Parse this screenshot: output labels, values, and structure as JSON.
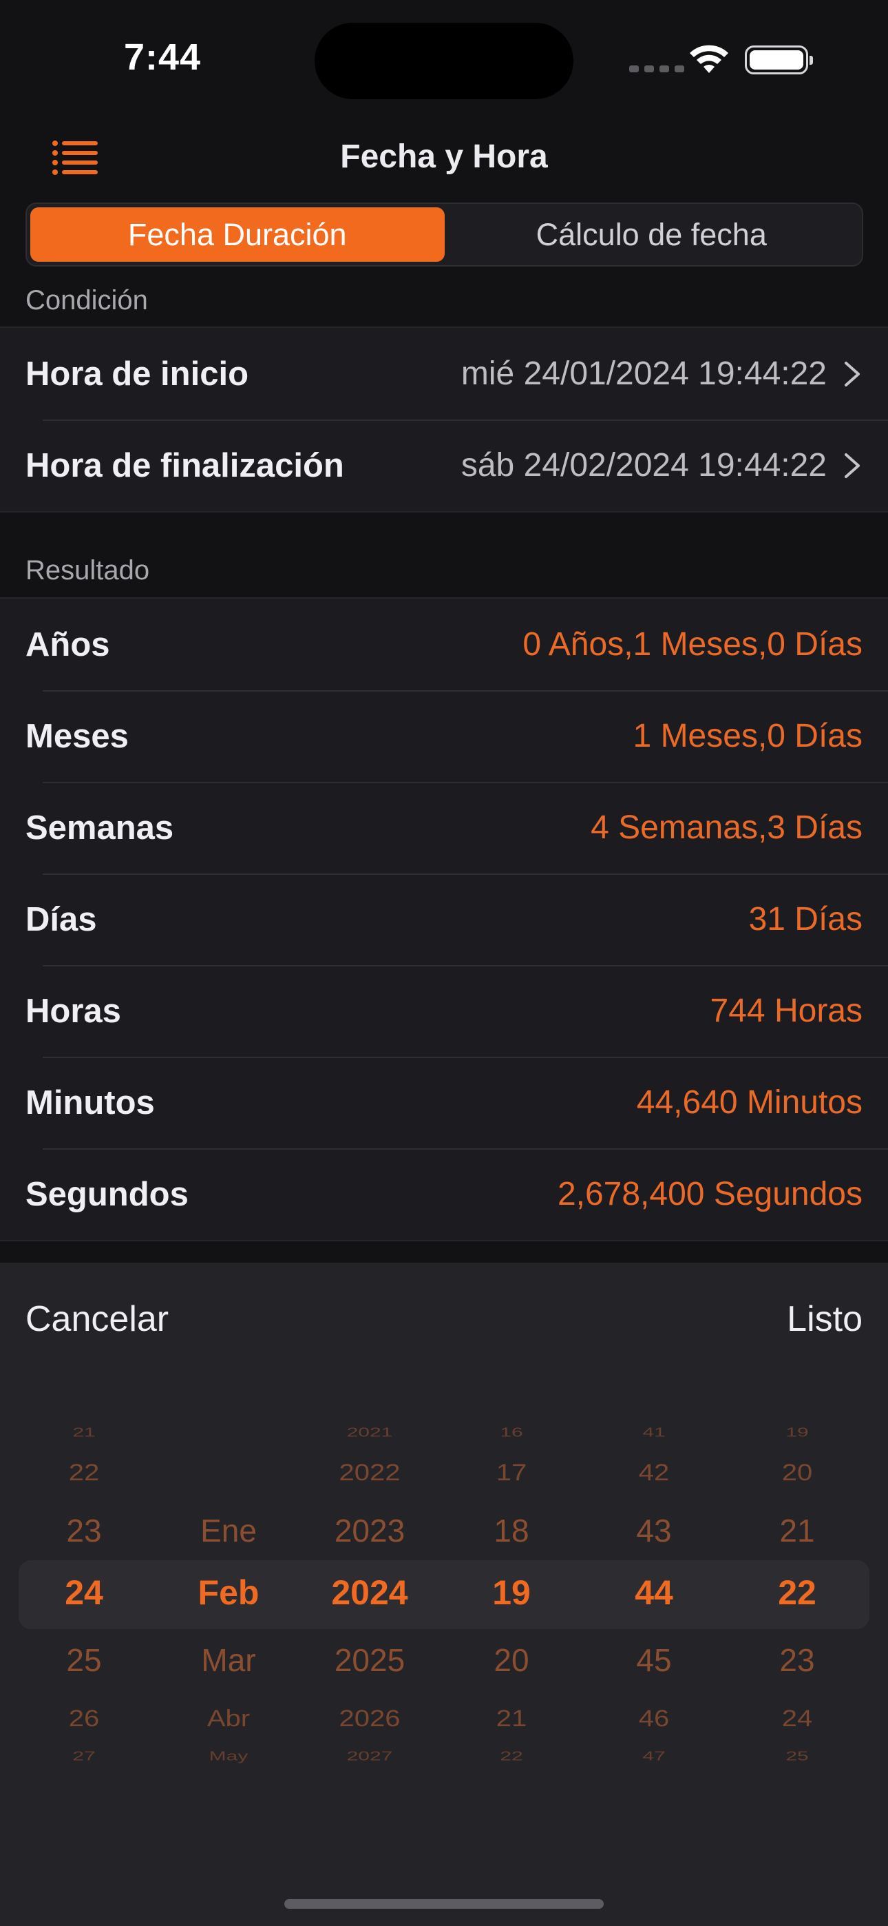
{
  "status_bar": {
    "time": "7:44"
  },
  "nav": {
    "title": "Fecha y Hora",
    "menu_icon": "list-icon"
  },
  "segmented": {
    "tabs": [
      "Fecha Duración",
      "Cálculo de fecha"
    ],
    "selected_index": 0
  },
  "condition": {
    "header": "Condición",
    "rows": [
      {
        "label": "Hora de inicio",
        "value": "mié 24/01/2024 19:44:22"
      },
      {
        "label": "Hora de finalización",
        "value": "sáb 24/02/2024 19:44:22"
      }
    ]
  },
  "result": {
    "header": "Resultado",
    "rows": [
      {
        "label": "Años",
        "value": "0 Años,1 Meses,0 Días"
      },
      {
        "label": "Meses",
        "value": "1 Meses,0 Días"
      },
      {
        "label": "Semanas",
        "value": "4 Semanas,3 Días"
      },
      {
        "label": "Días",
        "value": "31 Días"
      },
      {
        "label": "Horas",
        "value": "744 Horas"
      },
      {
        "label": "Minutos",
        "value": "44,640 Minutos"
      },
      {
        "label": "Segundos",
        "value": "2,678,400 Segundos"
      }
    ]
  },
  "picker": {
    "cancel_label": "Cancelar",
    "done_label": "Listo",
    "columns": [
      {
        "name": "day",
        "items": [
          "21",
          "22",
          "23",
          "24",
          "25",
          "26",
          "27"
        ],
        "selected": "24"
      },
      {
        "name": "month",
        "items": [
          "",
          "",
          "Ene",
          "Feb",
          "Mar",
          "Abr",
          "May"
        ],
        "selected": "Feb"
      },
      {
        "name": "year",
        "items": [
          "2021",
          "2022",
          "2023",
          "2024",
          "2025",
          "2026",
          "2027"
        ],
        "selected": "2024"
      },
      {
        "name": "hour",
        "items": [
          "16",
          "17",
          "18",
          "19",
          "20",
          "21",
          "22"
        ],
        "selected": "19"
      },
      {
        "name": "minute",
        "items": [
          "41",
          "42",
          "43",
          "44",
          "45",
          "46",
          "47"
        ],
        "selected": "44"
      },
      {
        "name": "second",
        "items": [
          "19",
          "20",
          "21",
          "22",
          "23",
          "24",
          "25"
        ],
        "selected": "22"
      }
    ]
  },
  "colors": {
    "accent": "#F26A1E",
    "background": "#121214",
    "cell": "#1C1C20",
    "sheet": "#232328"
  }
}
